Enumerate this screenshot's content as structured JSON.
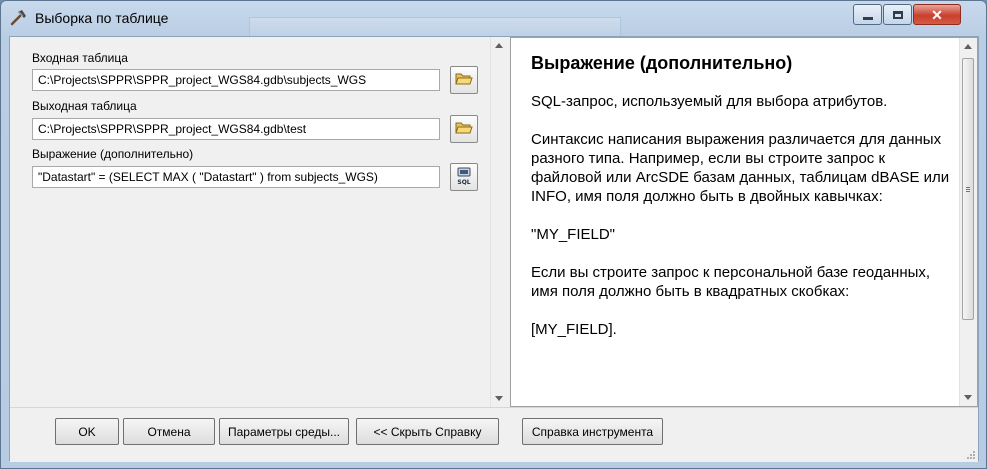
{
  "window": {
    "title": "Выборка по таблице"
  },
  "form": {
    "input_label": "Входная таблица",
    "input_value": "C:\\Projects\\SPPR\\SPPR_project_WGS84.gdb\\subjects_WGS",
    "output_label": "Выходная таблица",
    "output_value": "C:\\Projects\\SPPR\\SPPR_project_WGS84.gdb\\test",
    "expression_label": "Выражение (дополнительно)",
    "expression_value": "\"Datastart\" = (SELECT MAX ( \"Datastart\" ) from subjects_WGS)"
  },
  "help": {
    "title": "Выражение (дополнительно)",
    "paragraphs": [
      "SQL-запрос, используемый для выбора атрибутов.",
      "Синтаксис написания выражения различается для данных разного типа. Например, если вы строите запрос к файловой или ArcSDE базам данных, таблицам dBASE или INFO, имя поля должно быть в двойных кавычках:",
      "\"MY_FIELD\"",
      "Если вы строите запрос к персональной базе геоданных, имя поля должно быть в квадратных скобках:",
      "[MY_FIELD]."
    ]
  },
  "buttons": {
    "ok": "OK",
    "cancel": "Отмена",
    "environments": "Параметры среды...",
    "hide_help": "<< Скрыть Справку",
    "tool_help": "Справка инструмента"
  },
  "icons": {
    "title": "hammer-icon",
    "browse": "folder-open-icon",
    "sql": "sql-icon"
  }
}
